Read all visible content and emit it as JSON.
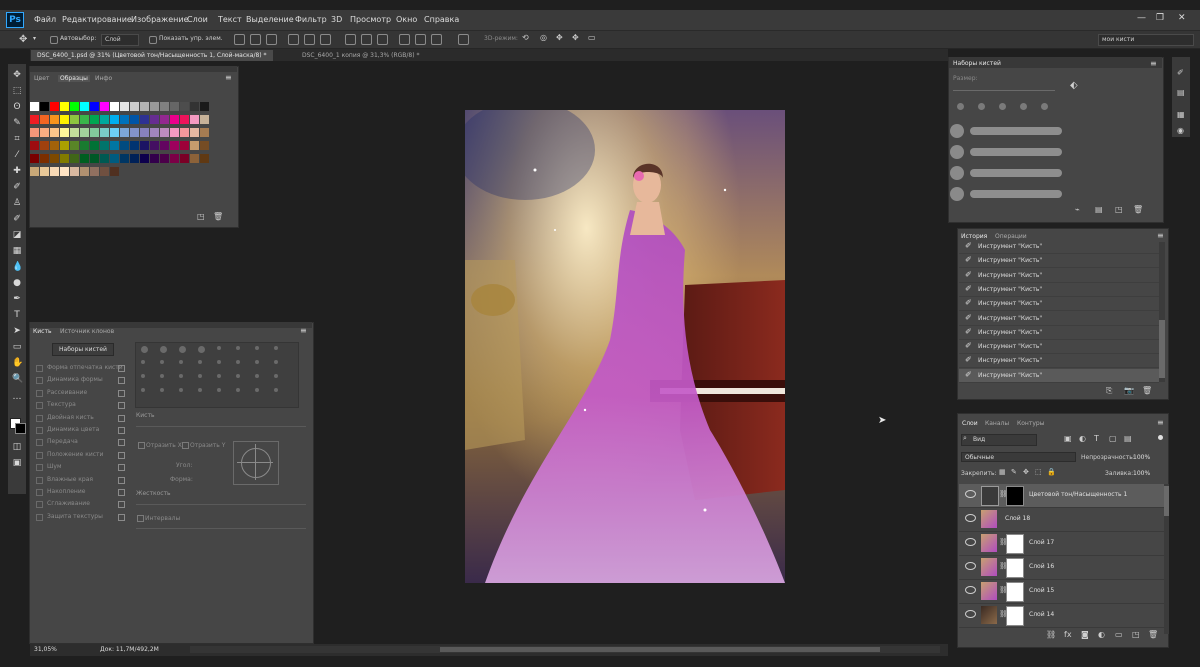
{
  "app": {
    "logo": "Ps"
  },
  "menu": [
    "Файл",
    "Редактирование",
    "Изображение",
    "Слои",
    "Текст",
    "Выделение",
    "Фильтр",
    "3D",
    "Просмотр",
    "Окно",
    "Справка"
  ],
  "options_bar": {
    "autoselect": "Автовыбор:",
    "autoselect_value": "Слой",
    "show_controls": "Показать упр. элем.",
    "mode_3d": "3D-режим:",
    "workspace": "мои кисти"
  },
  "doc_tabs": [
    {
      "label": "DSC_6400_1.psd @ 31% (Цветовой тон/Насыщенность 1, Слой-маска/8) *",
      "active": true
    },
    {
      "label": "DSC_6400_1 копия @ 31,3% (RGB/8) *",
      "active": false
    }
  ],
  "swatches_panel": {
    "tabs": [
      "Цвет",
      "Образцы",
      "Инфо"
    ],
    "colors": [
      "#ffffff",
      "#000000",
      "#ff0000",
      "#ffff00",
      "#00ff00",
      "#00ffff",
      "#0000ff",
      "#ff00ff",
      "#ffffff",
      "#e6e6e6",
      "#cccccc",
      "#b3b3b3",
      "#999999",
      "#808080",
      "#666666",
      "#4d4d4d",
      "#333333",
      "#1a1a1a",
      "#ed1c24",
      "#f26522",
      "#f7941d",
      "#fff200",
      "#8dc63f",
      "#39b54a",
      "#00a651",
      "#00a99d",
      "#00aeef",
      "#0072bc",
      "#0054a6",
      "#2e3192",
      "#662d91",
      "#92278f",
      "#ec008c",
      "#ed145b",
      "#f49ac1",
      "#c7b299",
      "#f69679",
      "#f9ad81",
      "#fdc68a",
      "#fff799",
      "#c4df9b",
      "#a3d39c",
      "#82ca9d",
      "#7accc8",
      "#6dcff6",
      "#7da7d9",
      "#8393ca",
      "#8781bd",
      "#a186be",
      "#bd8cbf",
      "#f49ac2",
      "#f6989d",
      "#e6b8a2",
      "#a67c52",
      "#9e0b0f",
      "#a0410d",
      "#a36209",
      "#aba000",
      "#598527",
      "#197b30",
      "#007236",
      "#00746b",
      "#0076a3",
      "#004b80",
      "#003471",
      "#1b1464",
      "#440e62",
      "#630460",
      "#9e005d",
      "#9e0039",
      "#c69c6d",
      "#754c24",
      "#790000",
      "#7b2e00",
      "#7d4900",
      "#827b00",
      "#406618",
      "#005e20",
      "#005826",
      "#005952",
      "#005b7f",
      "#003663",
      "#002157",
      "#0d004c",
      "#32004b",
      "#4b0049",
      "#7b0046",
      "#7a0026",
      "#8c6239",
      "#603913",
      "#c8a878",
      "#e8c898",
      "#f7d9b5",
      "#ffe4c4",
      "#d8b8a0",
      "#b09070",
      "#907060",
      "#705040",
      "#503020"
    ]
  },
  "brush_panel": {
    "tabs": [
      "Кисть",
      "Источник клонов"
    ],
    "presets_button": "Наборы кистей",
    "options": [
      "Форма отпечатка кисти",
      "Динамика формы",
      "Рассеивание",
      "Текстура",
      "Двойная кисть",
      "Динамика цвета",
      "Передача",
      "Положение кисти",
      "Шум",
      "Влажные края",
      "Накопление",
      "Сглаживание",
      "Защита текстуры"
    ],
    "size_label": "Кисть",
    "flip_x": "Отразить X",
    "flip_y": "Отразить Y",
    "angle": "Угол:",
    "roundness": "Форма:",
    "hardness": "Жесткость",
    "spacing": "Интервалы"
  },
  "brush_presets_panel": {
    "title": "Наборы кистей",
    "size_label": "Размер:"
  },
  "history_panel": {
    "tabs": [
      "История",
      "Операции"
    ],
    "items": [
      "Инструмент \"Кисть\"",
      "Инструмент \"Кисть\"",
      "Инструмент \"Кисть\"",
      "Инструмент \"Кисть\"",
      "Инструмент \"Кисть\"",
      "Инструмент \"Кисть\"",
      "Инструмент \"Кисть\"",
      "Инструмент \"Кисть\"",
      "Инструмент \"Кисть\"",
      "Инструмент \"Кисть\""
    ]
  },
  "layers_panel": {
    "tabs": [
      "Слои",
      "Каналы",
      "Контуры"
    ],
    "filter": "Вид",
    "blend_mode": "Обычные",
    "opacity_label": "Непрозрачность:",
    "opacity": "100%",
    "lock_label": "Закрепить:",
    "fill_label": "Заливка:",
    "fill": "100%",
    "layers": [
      {
        "name": "Цветовой тон/Насыщенность 1",
        "selected": true
      },
      {
        "name": "Слой 18",
        "selected": false
      },
      {
        "name": "Слой 17",
        "selected": false
      },
      {
        "name": "Слой 16",
        "selected": false
      },
      {
        "name": "Слой 15",
        "selected": false
      },
      {
        "name": "Слой 14",
        "selected": false
      }
    ]
  },
  "status": {
    "zoom": "31,05%",
    "doc": "Док: 11,7M/492,2M"
  }
}
